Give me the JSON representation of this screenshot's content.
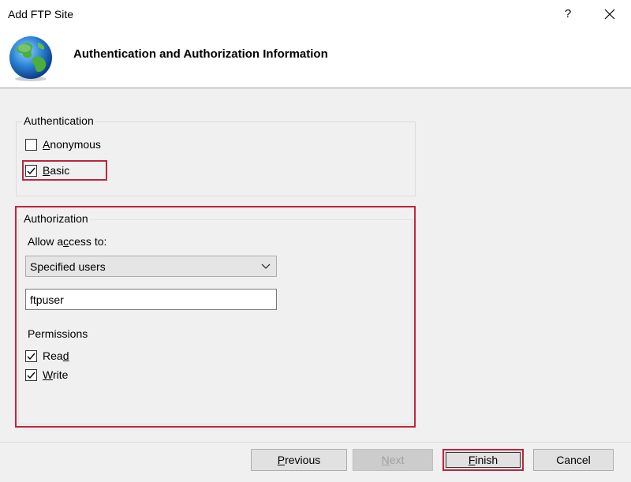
{
  "window": {
    "title": "Add FTP Site",
    "help_label": "?",
    "close_icon": "close-icon"
  },
  "header": {
    "title": "Authentication and Authorization Information",
    "icon": "globe-icon"
  },
  "authentication": {
    "group_label": "Authentication",
    "anonymous": {
      "label_prefix": "",
      "label_underline": "A",
      "label_rest": "nonymous",
      "checked": false
    },
    "basic": {
      "label_prefix": "",
      "label_underline": "B",
      "label_rest": "asic",
      "checked": true
    }
  },
  "authorization": {
    "group_label": "Authorization",
    "allow_access_prefix": "Allow a",
    "allow_access_underline": "c",
    "allow_access_rest": "cess to:",
    "selected_option": "Specified users",
    "users_value": "ftpuser",
    "permissions_label": "Permissions",
    "read": {
      "label_prefix": "Rea",
      "label_underline": "d",
      "label_rest": "",
      "checked": true
    },
    "write": {
      "label_prefix": "",
      "label_underline": "W",
      "label_rest": "rite",
      "checked": true
    }
  },
  "buttons": {
    "previous": {
      "label_underline": "P",
      "label_rest": "revious"
    },
    "next": {
      "label_underline": "N",
      "label_rest": "ext"
    },
    "finish": {
      "label_underline": "F",
      "label_rest": "inish"
    },
    "cancel": "Cancel"
  },
  "colors": {
    "highlight": "#c1233f"
  }
}
